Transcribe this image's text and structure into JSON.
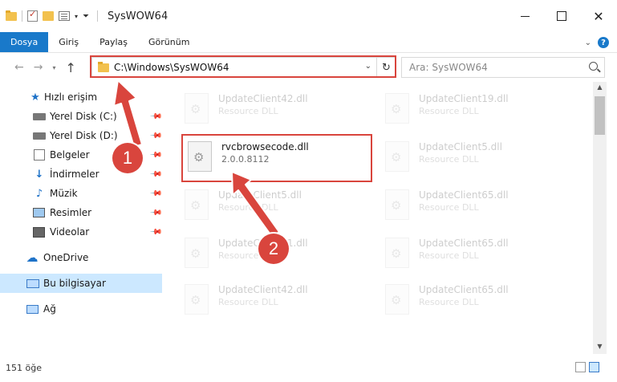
{
  "window": {
    "title": "SysWOW64"
  },
  "ribbon": {
    "tabs": [
      "Dosya",
      "Giriş",
      "Paylaş",
      "Görünüm"
    ]
  },
  "address": {
    "path": "C:\\Windows\\SysWOW64",
    "search_placeholder": "Ara: SysWOW64"
  },
  "sidebar": {
    "items": [
      {
        "label": "Hızlı erişim",
        "icon": "star-icon"
      },
      {
        "label": "Yerel Disk (C:)",
        "icon": "drive-icon"
      },
      {
        "label": "Yerel Disk (D:)",
        "icon": "drive-icon"
      },
      {
        "label": "Belgeler",
        "icon": "documents-icon"
      },
      {
        "label": "İndirmeler",
        "icon": "downloads-icon"
      },
      {
        "label": "Müzik",
        "icon": "music-icon"
      },
      {
        "label": "Resimler",
        "icon": "pictures-icon"
      },
      {
        "label": "Videolar",
        "icon": "videos-icon"
      },
      {
        "label": "OneDrive",
        "icon": "cloud-icon"
      },
      {
        "label": "Bu bilgisayar",
        "icon": "computer-icon"
      },
      {
        "label": "Ağ",
        "icon": "network-icon"
      }
    ]
  },
  "files": {
    "col1": [
      {
        "name": "UpdateClient42.dll",
        "desc": "Resource DLL"
      },
      {
        "name": "rvcbrowsecode.dll",
        "desc": "2.0.0.8112"
      },
      {
        "name": "UpdateClient5.dll",
        "desc": "Resource DLL"
      },
      {
        "name": "UpdateClient31.dll",
        "desc": "Resource DLL"
      },
      {
        "name": "UpdateClient42.dll",
        "desc": "Resource DLL"
      }
    ],
    "col2": [
      {
        "name": "UpdateClient19.dll",
        "desc": "Resource DLL"
      },
      {
        "name": "UpdateClient5.dll",
        "desc": "Resource DLL"
      },
      {
        "name": "UpdateClient65.dll",
        "desc": "Resource DLL"
      },
      {
        "name": "UpdateClient65.dll",
        "desc": "Resource DLL"
      },
      {
        "name": "UpdateClient65.dll",
        "desc": "Resource DLL"
      }
    ]
  },
  "status": {
    "count": "151 öğe"
  },
  "annotations": {
    "step1": "1",
    "step2": "2",
    "color": "#d9453d"
  }
}
